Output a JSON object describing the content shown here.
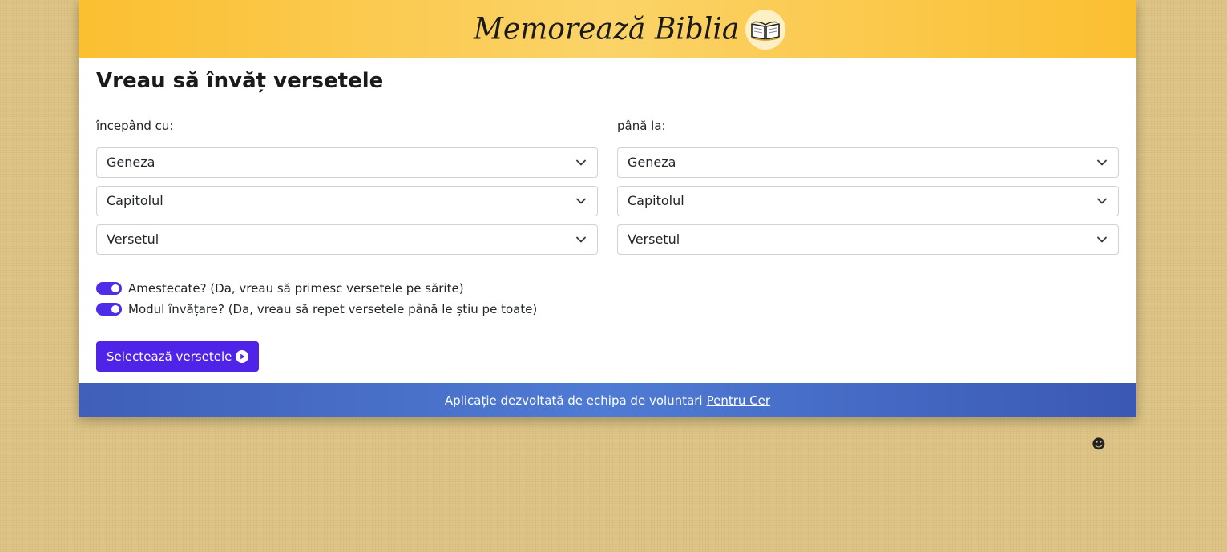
{
  "header": {
    "brand_title": "Memorează Biblia",
    "logo_icon": "open-book-icon"
  },
  "main": {
    "title": "Vreau să învăț versetele",
    "from": {
      "label": "începând cu:",
      "book": "Geneza",
      "chapter": "Capitolul",
      "verse": "Versetul"
    },
    "to": {
      "label": "până la:",
      "book": "Geneza",
      "chapter": "Capitolul",
      "verse": "Versetul"
    },
    "toggles": [
      {
        "label": "Amestecate? (Da, vreau să primesc versetele pe sărite)",
        "checked": true
      },
      {
        "label": "Modul învățare? (Da, vreau să repet versetele până le știu pe toate)",
        "checked": true
      }
    ],
    "submit_label": "Selectează versetele",
    "submit_icon": "play-circle-icon"
  },
  "footer": {
    "text": "Aplicație dezvoltată de echipa de voluntari",
    "link_label": "Pentru Cer"
  },
  "floating": {
    "smiley": "☻"
  },
  "colors": {
    "page_background": "#dec587",
    "header_gradient": "#fbbf31",
    "primary": "#4f23e8",
    "footer": "#4a6fc8"
  }
}
